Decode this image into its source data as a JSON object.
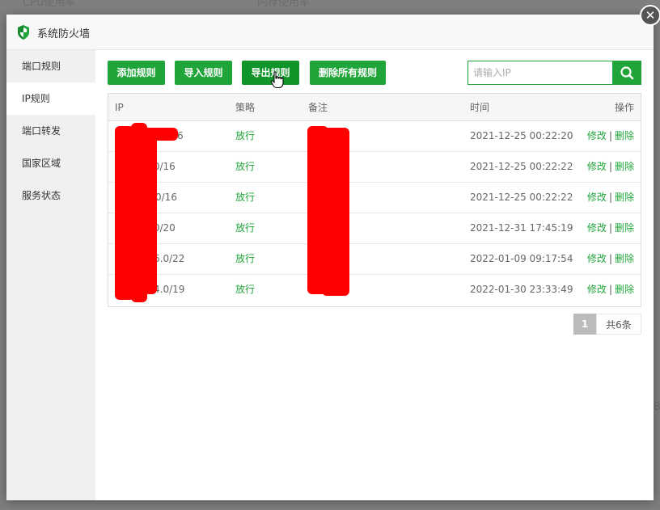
{
  "background": {
    "labels": [
      "CPU使用率",
      "内存使用率",
      "B"
    ]
  },
  "dialog": {
    "title": "系统防火墙",
    "close_symbol": "✕"
  },
  "sidebar": {
    "items": [
      {
        "label": "端口规则",
        "active": false
      },
      {
        "label": "IP规则",
        "active": true
      },
      {
        "label": "端口转发",
        "active": false
      },
      {
        "label": "国家区域",
        "active": false
      },
      {
        "label": "服务状态",
        "active": false
      }
    ]
  },
  "toolbar": {
    "add_label": "添加规则",
    "import_label": "导入规则",
    "export_label": "导出规则",
    "delete_all_label": "删除所有规则"
  },
  "search": {
    "placeholder": "请输入IP",
    "value": ""
  },
  "table": {
    "headers": {
      "ip": "IP",
      "policy": "策略",
      "note": "备注",
      "time": "时间",
      "action": "操作"
    },
    "rows": [
      {
        "ip": "6",
        "policy": "放行",
        "time": "2021-12-25 00:22:20"
      },
      {
        "ip": ".0/16",
        "policy": "放行",
        "time": "2021-12-25 00:22:22"
      },
      {
        "ip": "0/16",
        "policy": "放行",
        "time": "2021-12-25 00:22:22"
      },
      {
        "ip": ".0/20",
        "policy": "放行",
        "time": "2021-12-31 17:45:19"
      },
      {
        "ip": "6.0/22",
        "policy": "放行",
        "time": "2022-01-09 09:17:54"
      },
      {
        "ip": "4.0/19",
        "policy": "放行",
        "time": "2022-01-30 23:33:49"
      }
    ],
    "edit_label": "修改",
    "delete_label": "删除",
    "separator": "|"
  },
  "pagination": {
    "current": "1",
    "total": "共6条"
  },
  "colors": {
    "accent": "#20a53a",
    "redaction": "#ff0000"
  },
  "icons": [
    "shield-icon",
    "close-icon",
    "search-icon",
    "hand-cursor-icon"
  ]
}
